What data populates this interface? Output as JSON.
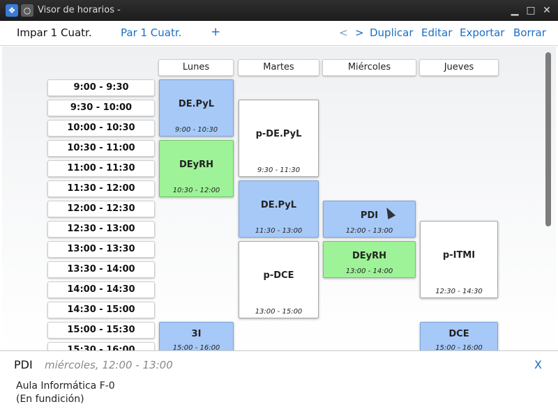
{
  "window": {
    "title": "Visor de horarios -",
    "minimize": "▁",
    "maximize": "□",
    "close": "✕"
  },
  "tabs": [
    {
      "label": "Impar 1 Cuatr."
    },
    {
      "label": "Par 1 Cuatr."
    },
    {
      "label": "+"
    }
  ],
  "actions": {
    "prev": "<",
    "next": ">",
    "duplicate": "Duplicar",
    "edit": "Editar",
    "export": "Exportar",
    "delete": "Borrar"
  },
  "days": [
    "Lunes",
    "Martes",
    "Miércoles",
    "Jueves"
  ],
  "slots": [
    "9:00 - 9:30",
    "9:30 - 10:00",
    "10:00 - 10:30",
    "10:30 - 11:00",
    "11:00 - 11:30",
    "11:30 - 12:00",
    "12:00 - 12:30",
    "12:30 - 13:00",
    "13:00 - 13:30",
    "13:30 - 14:00",
    "14:00 - 14:30",
    "14:30 - 15:00",
    "15:00 - 15:30",
    "15:30 - 16:00"
  ],
  "events": [
    {
      "name": "DE.PyL",
      "time": "9:00 - 10:30",
      "color": "#a7c9f7"
    },
    {
      "name": "DEyRH",
      "time": "10:30 - 12:00",
      "color": "#9ef297"
    },
    {
      "name": "3I",
      "time": "15:00 - 16:00",
      "color": "#a7c9f7"
    },
    {
      "name": "p-DE.PyL",
      "time": "9:30 - 11:30",
      "color": "#ffffff"
    },
    {
      "name": "DE.PyL",
      "time": "11:30 - 13:00",
      "color": "#a7c9f7"
    },
    {
      "name": "p-DCE",
      "time": "13:00 - 15:00",
      "color": "#ffffff"
    },
    {
      "name": "PDI",
      "time": "12:00 - 13:00",
      "color": "#a7c9f7"
    },
    {
      "name": "DEyRH",
      "time": "13:00 - 14:00",
      "color": "#9ef297"
    },
    {
      "name": "p-ITMI",
      "time": "12:30 - 14:30",
      "color": "#ffffff"
    },
    {
      "name": "DCE",
      "time": "15:00 - 16:00",
      "color": "#a7c9f7"
    }
  ],
  "info": {
    "name": "PDI",
    "when": "miércoles, 12:00 - 13:00",
    "close": "X",
    "room": "Aula Informática F-0",
    "status": "(En fundición)"
  }
}
